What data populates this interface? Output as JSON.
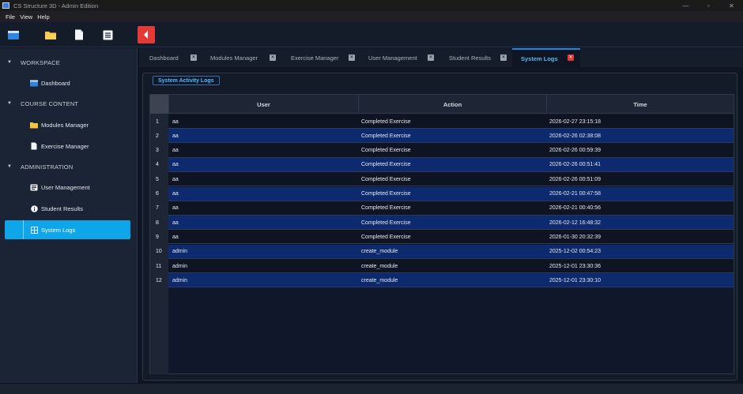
{
  "window": {
    "title": "CS Structure 3D - Admin Edition",
    "minimize": "—",
    "maximize": "▫",
    "close": "✕"
  },
  "menu": {
    "file": "File",
    "view": "View",
    "help": "Help"
  },
  "toolbar": {
    "buttons": [
      "monitor-icon",
      "folder-icon",
      "file-icon",
      "list-icon",
      "back-icon"
    ],
    "accent": "#e53935"
  },
  "sidebar": {
    "sections": {
      "workspace": "WORKSPACE",
      "course": "COURSE CONTENT",
      "admin": "ADMINISTRATION"
    },
    "items": {
      "dashboard": "Dashboard",
      "modules": "Modules Manager",
      "exercises": "Exercise Manager",
      "users": "User Management",
      "results": "Student Results",
      "logs": "System Logs"
    },
    "active_color": "#0ea5e9"
  },
  "tabs": [
    {
      "label": "Dashboard"
    },
    {
      "label": "Modules Manager"
    },
    {
      "label": "Exercise Manager"
    },
    {
      "label": "User Management"
    },
    {
      "label": "Student Results"
    },
    {
      "label": "System Logs",
      "active": true
    }
  ],
  "panel": {
    "title": "System Activity Logs"
  },
  "table": {
    "columns": [
      "User",
      "Action",
      "Time"
    ],
    "rows": [
      {
        "n": "1",
        "user": "aa",
        "action": "Completed Exercise",
        "time": "2026-02-27 23:15:18"
      },
      {
        "n": "2",
        "user": "aa",
        "action": "Completed Exercise",
        "time": "2026-02-26 02:38:08"
      },
      {
        "n": "3",
        "user": "aa",
        "action": "Completed Exercise",
        "time": "2026-02-26 00:59:39"
      },
      {
        "n": "4",
        "user": "aa",
        "action": "Completed Exercise",
        "time": "2026-02-26 00:51:41"
      },
      {
        "n": "5",
        "user": "aa",
        "action": "Completed Exercise",
        "time": "2026-02-26 00:51:09"
      },
      {
        "n": "6",
        "user": "aa",
        "action": "Completed Exercise",
        "time": "2026-02-21 00:47:58"
      },
      {
        "n": "7",
        "user": "aa",
        "action": "Completed Exercise",
        "time": "2026-02-21 00:40:56"
      },
      {
        "n": "8",
        "user": "aa",
        "action": "Completed Exercise",
        "time": "2026-02-12 16:48:32"
      },
      {
        "n": "9",
        "user": "aa",
        "action": "Completed Exercise",
        "time": "2026-01-30 20:32:39"
      },
      {
        "n": "10",
        "user": "admin",
        "action": "create_module",
        "time": "2025-12-02 00:54:23"
      },
      {
        "n": "11",
        "user": "admin",
        "action": "create_module",
        "time": "2025-12-01 23:30:36"
      },
      {
        "n": "12",
        "user": "admin",
        "action": "create_module",
        "time": "2025-12-01 23:30:10"
      }
    ]
  }
}
